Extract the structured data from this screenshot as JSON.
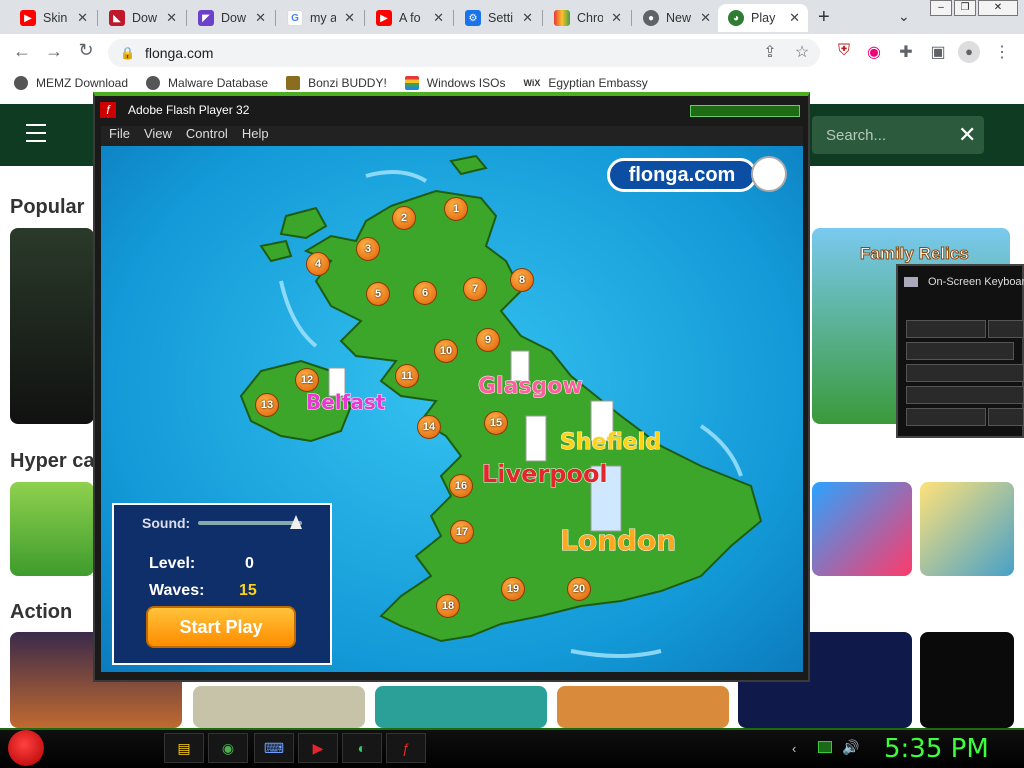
{
  "tabs": [
    {
      "title": "Skin",
      "icon": "youtube-icon",
      "color": "#ff0000"
    },
    {
      "title": "Dow",
      "icon": "download-site-icon",
      "color": "#c0182a"
    },
    {
      "title": "Dow",
      "icon": "download-site-icon-2",
      "color": "#6c40c8"
    },
    {
      "title": "my a",
      "icon": "google-icon",
      "color": "#4285f4"
    },
    {
      "title": "A fo",
      "icon": "youtube-icon",
      "color": "#ff0000"
    },
    {
      "title": "Setti",
      "icon": "settings-gear-icon",
      "color": "#1a73e8"
    },
    {
      "title": "Chro",
      "icon": "chrome-rainbow-icon",
      "color": "#e6a23c"
    },
    {
      "title": "New",
      "icon": "chrome-icon",
      "color": "#5f6368"
    },
    {
      "title": "Play",
      "icon": "flonga-icon",
      "color": "#2e7d32"
    }
  ],
  "url": "flonga.com",
  "bookmarks": [
    {
      "label": "MEMZ Download",
      "color": "#444"
    },
    {
      "label": "Malware Database",
      "color": "#444"
    },
    {
      "label": "Bonzi BUDDY!",
      "color": "#8a6d1f"
    },
    {
      "label": "Windows ISOs",
      "color": "#d93025"
    },
    {
      "label": "Egyptian Embassy",
      "color": "#111"
    }
  ],
  "wix": "WiX",
  "site": {
    "search_placeholder": "Search...",
    "sections": [
      "Popular",
      "Hyper ca",
      "Action"
    ],
    "family_banner": "Family Relics"
  },
  "flash": {
    "title": "Adobe Flash Player 32",
    "menu": [
      "File",
      "View",
      "Control",
      "Help"
    ],
    "logo": "flonga.com",
    "cities": [
      {
        "name": "Glasgow",
        "color": "#ff5fa0"
      },
      {
        "name": "Belfast",
        "color": "#e83ad0"
      },
      {
        "name": "Shefield",
        "color": "#ffd21a"
      },
      {
        "name": "Liverpool",
        "color": "#e3262b"
      },
      {
        "name": "London",
        "color": "#ffa820"
      }
    ],
    "levels": [
      "1",
      "2",
      "3",
      "4",
      "5",
      "6",
      "7",
      "8",
      "9",
      "10",
      "11",
      "12",
      "13",
      "14",
      "15",
      "16",
      "17",
      "18",
      "19",
      "20"
    ],
    "panel": {
      "sound_label": "Sound:",
      "level_label": "Level:",
      "level_value": "0",
      "waves_label": "Waves:",
      "waves_value": "15",
      "start": "Start Play"
    }
  },
  "osk": {
    "title": "On-Screen Keyboard"
  },
  "taskbar": {
    "clock": "5:35 PM"
  }
}
